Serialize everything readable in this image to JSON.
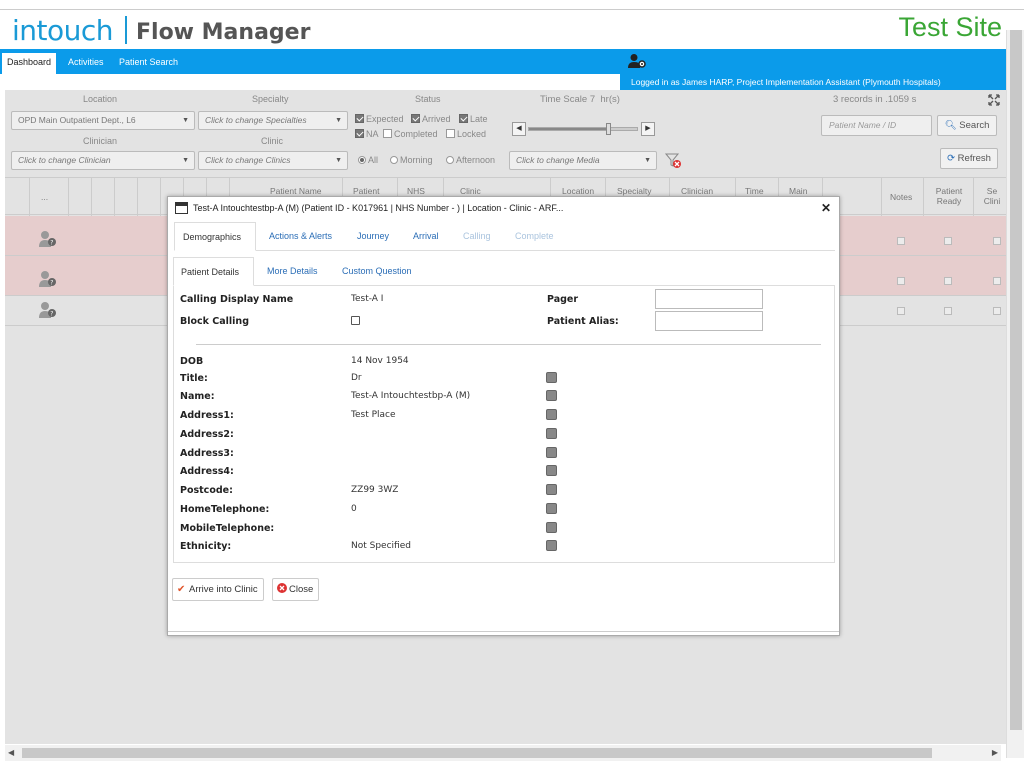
{
  "header": {
    "logo": "intouch",
    "app_name": "Flow Manager",
    "site_label": "Test Site",
    "nav_tabs": [
      "Dashboard",
      "Activities",
      "Patient Search"
    ],
    "logged_in_text": "Logged in as James HARP, Project Implementation Assistant (Plymouth Hospitals)"
  },
  "filters": {
    "location_label": "Location",
    "location_value": "OPD Main Outpatient Dept., L6",
    "specialty_label": "Specialty",
    "specialty_placeholder": "Click to change Specialties",
    "clinician_label": "Clinician",
    "clinician_placeholder": "Click to change Clinician",
    "clinic_label": "Clinic",
    "clinic_placeholder": "Click to change Clinics",
    "status_label": "Status",
    "status_expected": "Expected",
    "status_arrived": "Arrived",
    "status_late": "Late",
    "status_na": "NA",
    "status_completed": "Completed",
    "status_locked": "Locked",
    "time_all": "All",
    "time_morning": "Morning",
    "time_afternoon": "Afternoon",
    "time_scale_label": "Time Scale",
    "time_scale_value": "7",
    "time_scale_unit": "hr(s)",
    "media_placeholder": "Click to change Media",
    "records_text": "3 records in .1059 s",
    "patient_search_placeholder": "Patient Name / ID",
    "search_button": "Search",
    "refresh_button": "Refresh"
  },
  "grid": {
    "headers": [
      "...",
      "Patient Name",
      "Patient",
      "NHS",
      "Clinic",
      "Location",
      "Specialty",
      "Clinician",
      "Time",
      "Main",
      "Notes",
      "Patient Ready",
      "Se Clini"
    ]
  },
  "dialog": {
    "title": "Test-A Intouchtestbp-A (M) (Patient ID - K017961 | NHS Number - ) | Location - Clinic - ARF...",
    "tabs": [
      "Demographics",
      "Actions & Alerts",
      "Journey",
      "Arrival",
      "Calling",
      "Complete"
    ],
    "subtabs": [
      "Patient Details",
      "More Details",
      "Custom Question"
    ],
    "calling_display_name_label": "Calling Display Name",
    "calling_display_name_value": "Test-A I",
    "block_calling_label": "Block Calling",
    "pager_label": "Pager",
    "patient_alias_label": "Patient Alias:",
    "details": [
      {
        "label": "DOB",
        "value": "14 Nov 1954"
      },
      {
        "label": "Title:",
        "value": "Dr"
      },
      {
        "label": "Name:",
        "value": "Test-A Intouchtestbp-A (M)"
      },
      {
        "label": "Address1:",
        "value": "Test Place"
      },
      {
        "label": "Address2:",
        "value": ""
      },
      {
        "label": "Address3:",
        "value": ""
      },
      {
        "label": "Address4:",
        "value": ""
      },
      {
        "label": "Postcode:",
        "value": "ZZ99 3WZ"
      },
      {
        "label": "HomeTelephone:",
        "value": "0"
      },
      {
        "label": "MobileTelephone:",
        "value": ""
      },
      {
        "label": "Ethnicity:",
        "value": "Not Specified"
      }
    ],
    "arrive_button": "Arrive into Clinic",
    "close_button": "Close"
  }
}
